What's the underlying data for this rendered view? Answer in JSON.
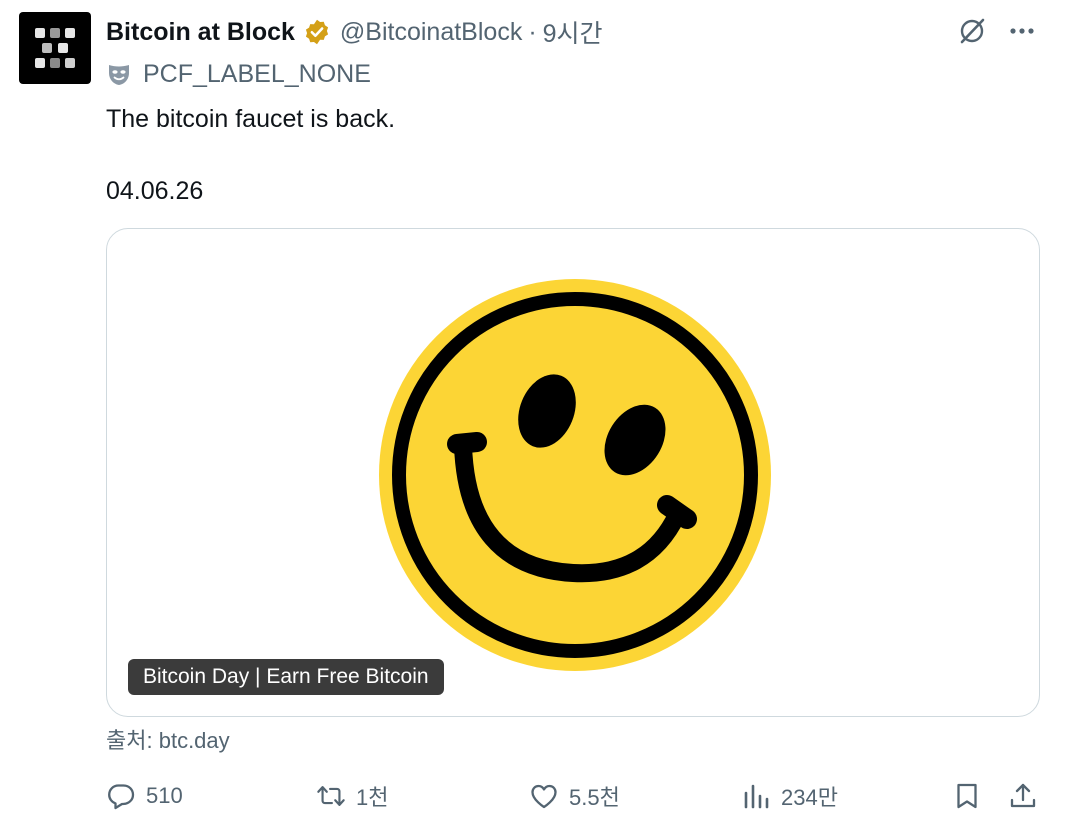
{
  "author": {
    "display_name": "Bitcoin at Block",
    "handle": "@BitcoinatBlock",
    "separator": "·",
    "time": "9시간",
    "label": "PCF_LABEL_NONE"
  },
  "tweet": {
    "text": "The bitcoin faucet is back.",
    "date": "04.06.26"
  },
  "card": {
    "title": "Bitcoin Day | Earn Free Bitcoin",
    "source_prefix": "출처:",
    "source_domain": "btc.day"
  },
  "actions": {
    "reply_count": "510",
    "repost_count": "1천",
    "like_count": "5.5천",
    "view_count": "234만"
  },
  "colors": {
    "accent_verified": "#d4a017",
    "muted_text": "#536471",
    "smiley_fill": "#fcd535",
    "smiley_stroke": "#000000"
  },
  "icons": [
    "verified-badge-icon",
    "grok-icon",
    "more-icon",
    "mask-icon",
    "reply-icon",
    "repost-icon",
    "like-icon",
    "views-icon",
    "bookmark-icon",
    "share-icon"
  ]
}
